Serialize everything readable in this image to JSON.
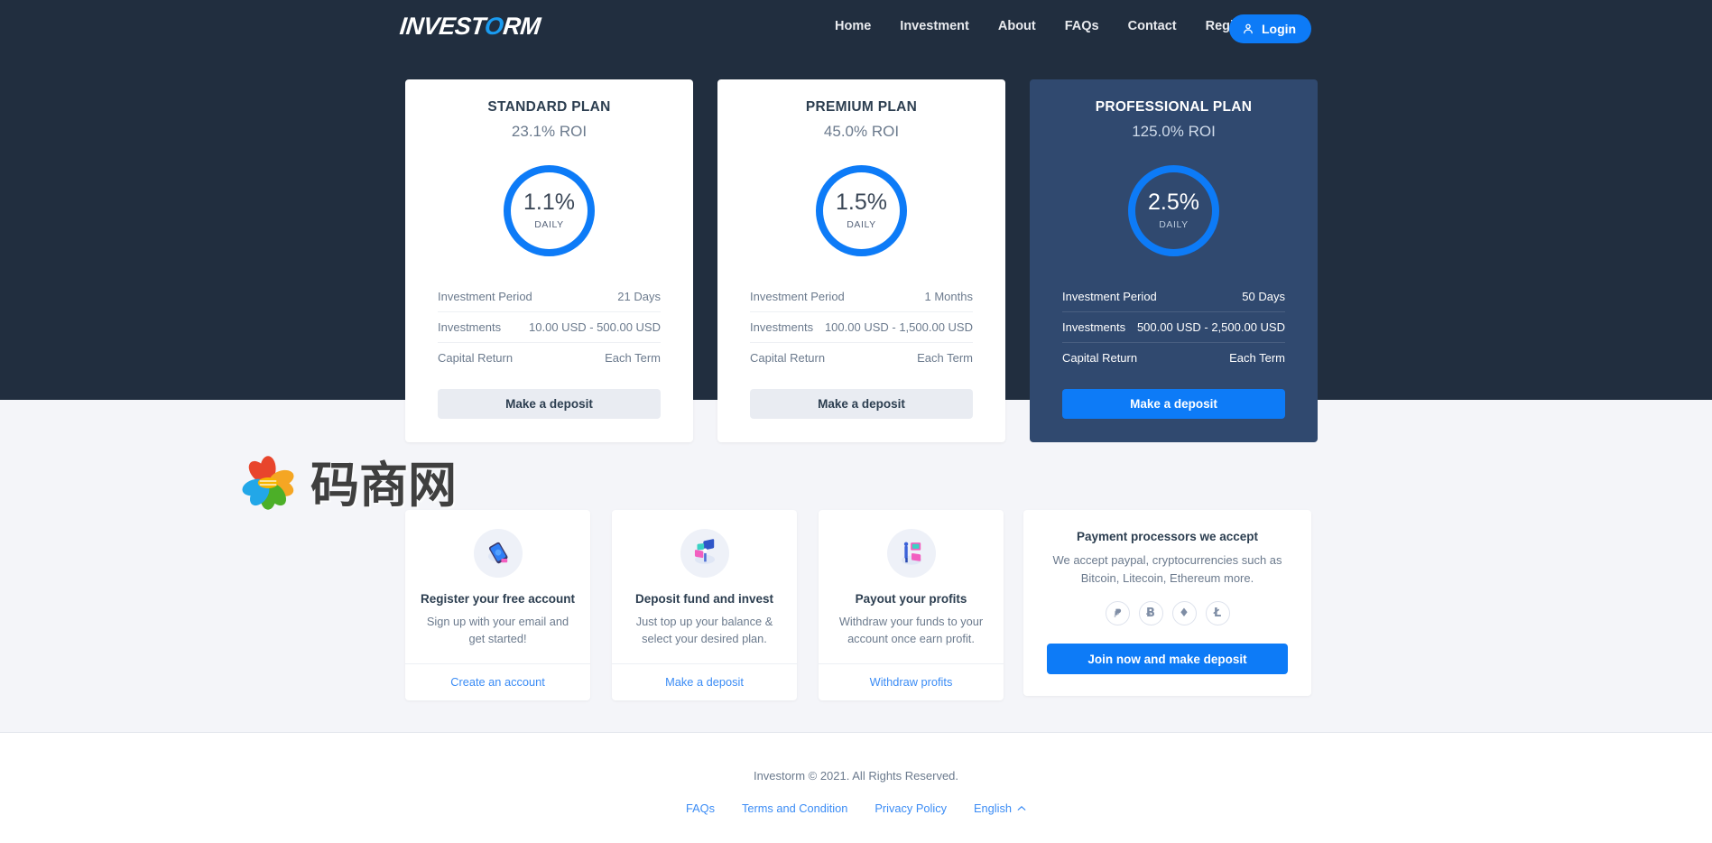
{
  "brand": {
    "text_a": "INVEST",
    "text_o": "O",
    "text_b": "RM",
    "accent_color": "#1a9bf0"
  },
  "nav": {
    "links": [
      {
        "label": "Home"
      },
      {
        "label": "Investment"
      },
      {
        "label": "About"
      },
      {
        "label": "FAQs"
      },
      {
        "label": "Contact"
      },
      {
        "label": "Register"
      }
    ],
    "login_label": "Login",
    "login_icon": "user-icon"
  },
  "theme": {
    "hero_bg": "#212e3f",
    "light_bg": "#f4f5f9",
    "accent": "#0d7bf7",
    "featured_card_bg": "#30496f"
  },
  "plans": [
    {
      "name": "STANDARD PLAN",
      "roi": "23.1% ROI",
      "gauge_value": "1.1%",
      "gauge_label": "DAILY",
      "rows": [
        {
          "label": "Investment Period",
          "value": "21 Days"
        },
        {
          "label": "Investments",
          "value": "10.00 USD - 500.00 USD"
        },
        {
          "label": "Capital Return",
          "value": "Each Term"
        }
      ],
      "cta": "Make a deposit",
      "featured": false
    },
    {
      "name": "PREMIUM PLAN",
      "roi": "45.0% ROI",
      "gauge_value": "1.5%",
      "gauge_label": "DAILY",
      "rows": [
        {
          "label": "Investment Period",
          "value": "1 Months"
        },
        {
          "label": "Investments",
          "value": "100.00 USD - 1,500.00 USD"
        },
        {
          "label": "Capital Return",
          "value": "Each Term"
        }
      ],
      "cta": "Make a deposit",
      "featured": false
    },
    {
      "name": "PROFESSIONAL PLAN",
      "roi": "125.0% ROI",
      "gauge_value": "2.5%",
      "gauge_label": "DAILY",
      "rows": [
        {
          "label": "Investment Period",
          "value": "50 Days"
        },
        {
          "label": "Investments",
          "value": "500.00 USD - 2,500.00 USD"
        },
        {
          "label": "Capital Return",
          "value": "Each Term"
        }
      ],
      "cta": "Make a deposit",
      "featured": true
    }
  ],
  "features": [
    {
      "icon": "phone-illustration-icon",
      "title": "Register your free account",
      "desc": "Sign up with your email and get started!",
      "link": "Create an account"
    },
    {
      "icon": "deposit-illustration-icon",
      "title": "Deposit fund and invest",
      "desc": "Just top up your balance & select your desired plan.",
      "link": "Make a deposit"
    },
    {
      "icon": "payout-illustration-icon",
      "title": "Payout your profits",
      "desc": "Withdraw your funds to your account once earn profit.",
      "link": "Withdraw profits"
    }
  ],
  "payments": {
    "title": "Payment processors we accept",
    "desc": "We accept paypal, cryptocurrencies such as Bitcoin, Litecoin, Ethereum more.",
    "icons": [
      {
        "name": "paypal-icon",
        "glyph": "ᵟ"
      },
      {
        "name": "bitcoin-icon",
        "glyph": "Ƀ"
      },
      {
        "name": "ethereum-icon",
        "glyph": "♦"
      },
      {
        "name": "litecoin-icon",
        "glyph": "Ł"
      }
    ],
    "cta": "Join now and make deposit"
  },
  "watermark": {
    "text": "码商网",
    "logo": "flower-logo-icon"
  },
  "footer": {
    "copyright": "Investorm © 2021. All Rights Reserved.",
    "links": [
      {
        "label": "FAQs"
      },
      {
        "label": "Terms and Condition"
      },
      {
        "label": "Privacy Policy"
      }
    ],
    "language": "English",
    "language_icon": "chevron-up-icon"
  }
}
